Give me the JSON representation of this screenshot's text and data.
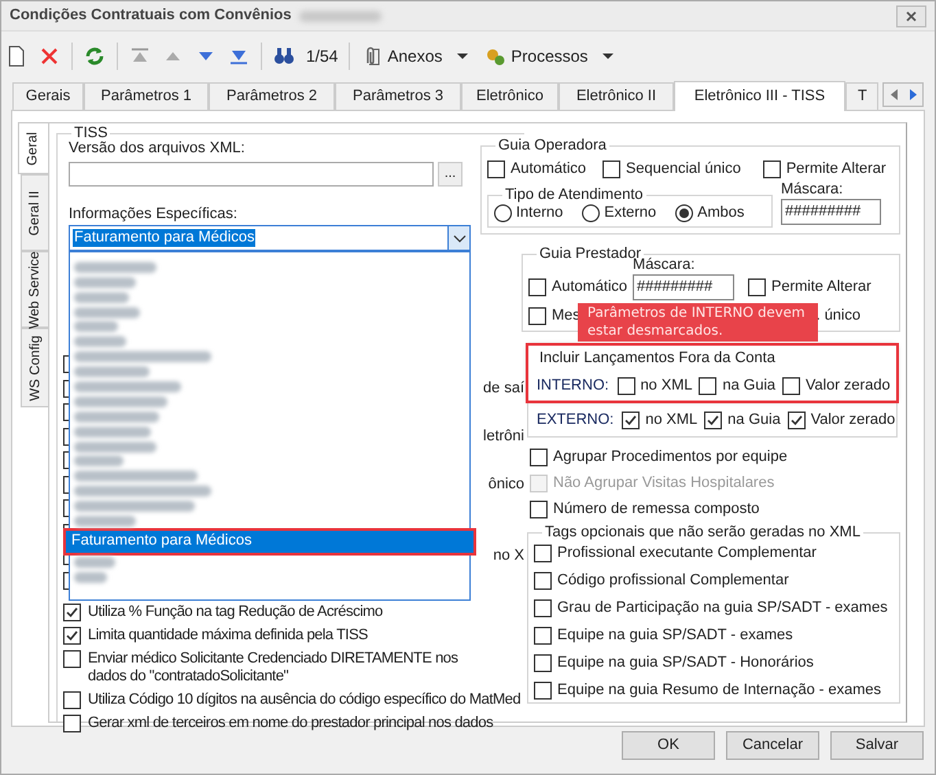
{
  "window": {
    "title": "Condições Contratuais com Convênios"
  },
  "toolbar": {
    "record_counter": "1/54",
    "menus": [
      {
        "label": "Anexos"
      },
      {
        "label": "Processos"
      }
    ]
  },
  "tabs": [
    {
      "label": "Gerais",
      "selected": false
    },
    {
      "label": "Parâmetros 1",
      "selected": false
    },
    {
      "label": "Parâmetros 2",
      "selected": false
    },
    {
      "label": "Parâmetros 3",
      "selected": false
    },
    {
      "label": "Eletrônico",
      "selected": false
    },
    {
      "label": "Eletrônico II",
      "selected": false
    },
    {
      "label": "Eletrônico III - TISS",
      "selected": true
    },
    {
      "label": "T",
      "selected": false
    }
  ],
  "side_tabs": [
    {
      "label": "Geral",
      "selected": true
    },
    {
      "label": "Geral II",
      "selected": false
    },
    {
      "label": "Web Service",
      "selected": false
    },
    {
      "label": "WS Config",
      "selected": false
    }
  ],
  "tiss": {
    "title": "TISS",
    "xml_version": {
      "label": "Versão dos arquivos XML:",
      "button": "..."
    },
    "specific_info": {
      "label": "Informações Específicas:",
      "value": "Faturamento para Médicos",
      "expanded": true,
      "options": [
        {
          "label": "Faturamento para Médicos",
          "selected": true,
          "highlighted": true
        }
      ]
    },
    "hidden_rows": [
      {
        "text": "de saí"
      },
      {
        "text": "letrôni"
      },
      {
        "text": "ônico"
      },
      {
        "text": "no X"
      }
    ],
    "options": [
      {
        "label": "Utiliza % Função na tag Redução de Acréscimo",
        "checked": true
      },
      {
        "label": "Limita quantidade máxima definida pela TISS",
        "checked": true
      },
      {
        "label": "Enviar médico Solicitante Credenciado DIRETAMENTE nos dados do \"contratadoSolicitante\"",
        "checked": false
      },
      {
        "label": "Utiliza Código 10 dígitos na ausência do código específico do MatMed",
        "checked": false
      },
      {
        "label": "Gerar xml de terceiros em nome do prestador principal nos dados",
        "checked": false
      }
    ]
  },
  "guia_operadora": {
    "title": "Guia Operadora",
    "checks": [
      {
        "label": "Automático",
        "checked": false
      },
      {
        "label": "Sequencial único",
        "checked": false
      },
      {
        "label": "Permite Alterar",
        "checked": false
      }
    ],
    "tipo_atendimento": {
      "title": "Tipo de Atendimento",
      "options": [
        {
          "label": "Interno",
          "selected": false
        },
        {
          "label": "Externo",
          "selected": false
        },
        {
          "label": "Ambos",
          "selected": true
        }
      ]
    },
    "mask": {
      "label": "Máscara:",
      "value": "#########"
    }
  },
  "guia_prestador": {
    "title": "Guia Prestador",
    "mask": {
      "label": "Máscara:",
      "value": "#########"
    },
    "checks": [
      {
        "label": "Automático",
        "checked": false
      },
      {
        "label": "Permite Alterar",
        "checked": false
      },
      {
        "label": "Mes",
        "checked": false
      },
      {
        "label": ". único"
      }
    ]
  },
  "tooltip": "Parâmetros de INTERNO devem estar desmarcados.",
  "fora_da_conta": {
    "title": "Incluir Lançamentos Fora da Conta",
    "highlighted": true,
    "rows": [
      {
        "label": "INTERNO:",
        "options": [
          {
            "label": "no XML",
            "checked": false
          },
          {
            "label": "na Guia",
            "checked": false
          },
          {
            "label": "Valor zerado",
            "checked": false
          }
        ]
      },
      {
        "label": "EXTERNO:",
        "options": [
          {
            "label": "no XML",
            "checked": true
          },
          {
            "label": "na Guia",
            "checked": true
          },
          {
            "label": "Valor zerado",
            "checked": true
          }
        ]
      }
    ]
  },
  "grouping": [
    {
      "label": "Agrupar Procedimentos por equipe",
      "checked": false,
      "disabled": false
    },
    {
      "label": "Não Agrupar Visitas Hospitalares",
      "checked": false,
      "disabled": true
    },
    {
      "label": "Número de remessa composto",
      "checked": false,
      "disabled": false
    }
  ],
  "optional_tags": {
    "title": "Tags opcionais que não serão geradas no XML",
    "items": [
      {
        "label": "Profissional executante Complementar",
        "checked": false
      },
      {
        "label": "Código profissional Complementar",
        "checked": false
      },
      {
        "label": "Grau de Participação na guia SP/SADT - exames",
        "checked": false
      },
      {
        "label": "Equipe na guia SP/SADT - exames",
        "checked": false
      },
      {
        "label": "Equipe na guia SP/SADT - Honorários",
        "checked": false
      },
      {
        "label": "Equipe na guia Resumo de Internação - exames",
        "checked": false
      }
    ]
  },
  "buttons": [
    {
      "label": "OK"
    },
    {
      "label": "Cancelar"
    },
    {
      "label": "Salvar"
    }
  ]
}
